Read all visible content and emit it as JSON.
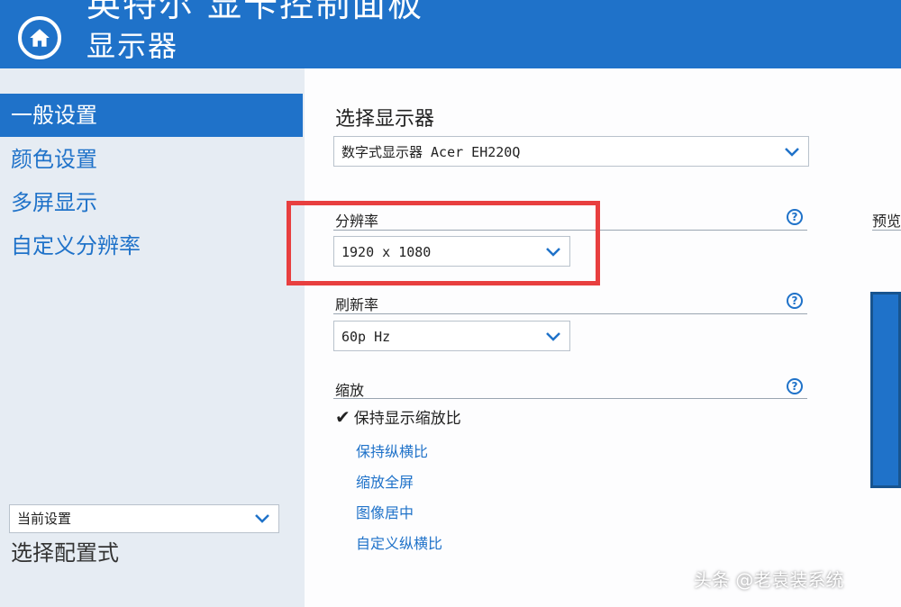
{
  "header": {
    "top_title": "英特尔 显卡控制面板",
    "title": "显示器"
  },
  "sidebar": {
    "items": [
      {
        "label": "一般设置",
        "active": true
      },
      {
        "label": "颜色设置",
        "active": false
      },
      {
        "label": "多屏显示",
        "active": false
      },
      {
        "label": "自定义分辨率",
        "active": false
      }
    ],
    "profile_label": "选择配置式",
    "profile_value": "当前设置"
  },
  "main": {
    "select_display_label": "选择显示器",
    "display_value": "数字式显示器 Acer EH220Q",
    "resolution_label": "分辨率",
    "resolution_value": "1920 x 1080",
    "refresh_label": "刷新率",
    "refresh_value": "60p Hz",
    "scaling_label": "缩放",
    "help_glyph": "?",
    "scaling_options": [
      {
        "label": "保持显示缩放比",
        "checked": true
      },
      {
        "label": "保持纵横比",
        "checked": false
      },
      {
        "label": "缩放全屏",
        "checked": false
      },
      {
        "label": "图像居中",
        "checked": false
      },
      {
        "label": "自定义纵横比",
        "checked": false
      }
    ],
    "preview_label": "预览"
  },
  "watermark": "头条 @老袁装系统",
  "colors": {
    "accent": "#1f72c9",
    "highlight_box": "#e83f3f"
  }
}
